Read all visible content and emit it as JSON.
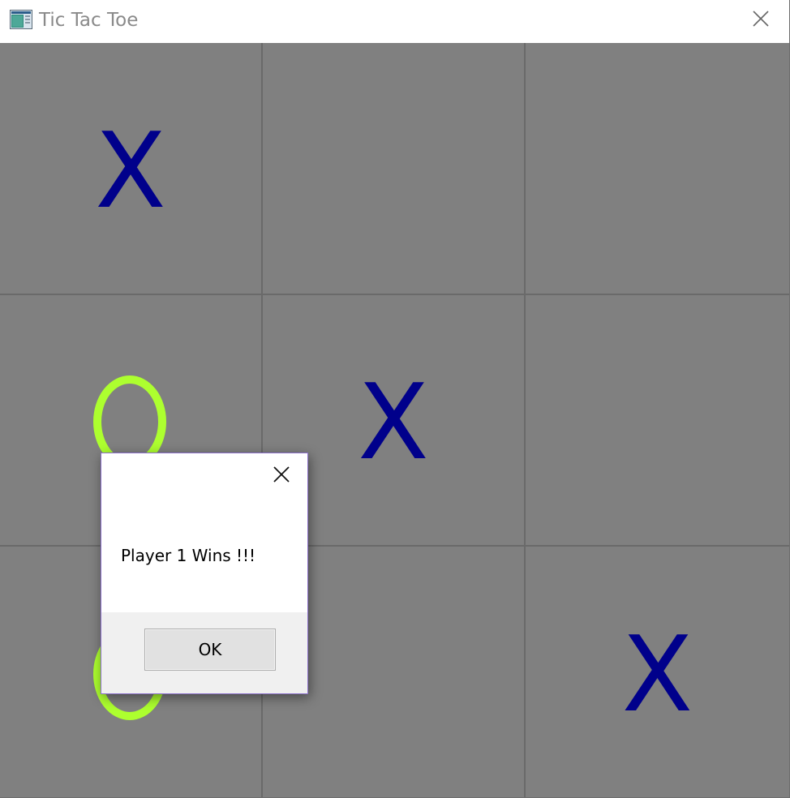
{
  "window": {
    "title": "Tic Tac Toe"
  },
  "board": {
    "cells": [
      {
        "mark": "X",
        "color": "#00008b"
      },
      {
        "mark": "",
        "color": ""
      },
      {
        "mark": "",
        "color": ""
      },
      {
        "mark": "O",
        "color": "#adff2f"
      },
      {
        "mark": "X",
        "color": "#00008b"
      },
      {
        "mark": "",
        "color": ""
      },
      {
        "mark": "O",
        "color": "#adff2f"
      },
      {
        "mark": "",
        "color": ""
      },
      {
        "mark": "X",
        "color": "#00008b"
      }
    ],
    "background_color": "#808080",
    "grid_line_color": "#6a6a6a"
  },
  "dialog": {
    "message": "Player 1 Wins !!!",
    "ok_label": "OK"
  },
  "icons": {
    "app": "app-window-icon",
    "close": "close-icon"
  }
}
